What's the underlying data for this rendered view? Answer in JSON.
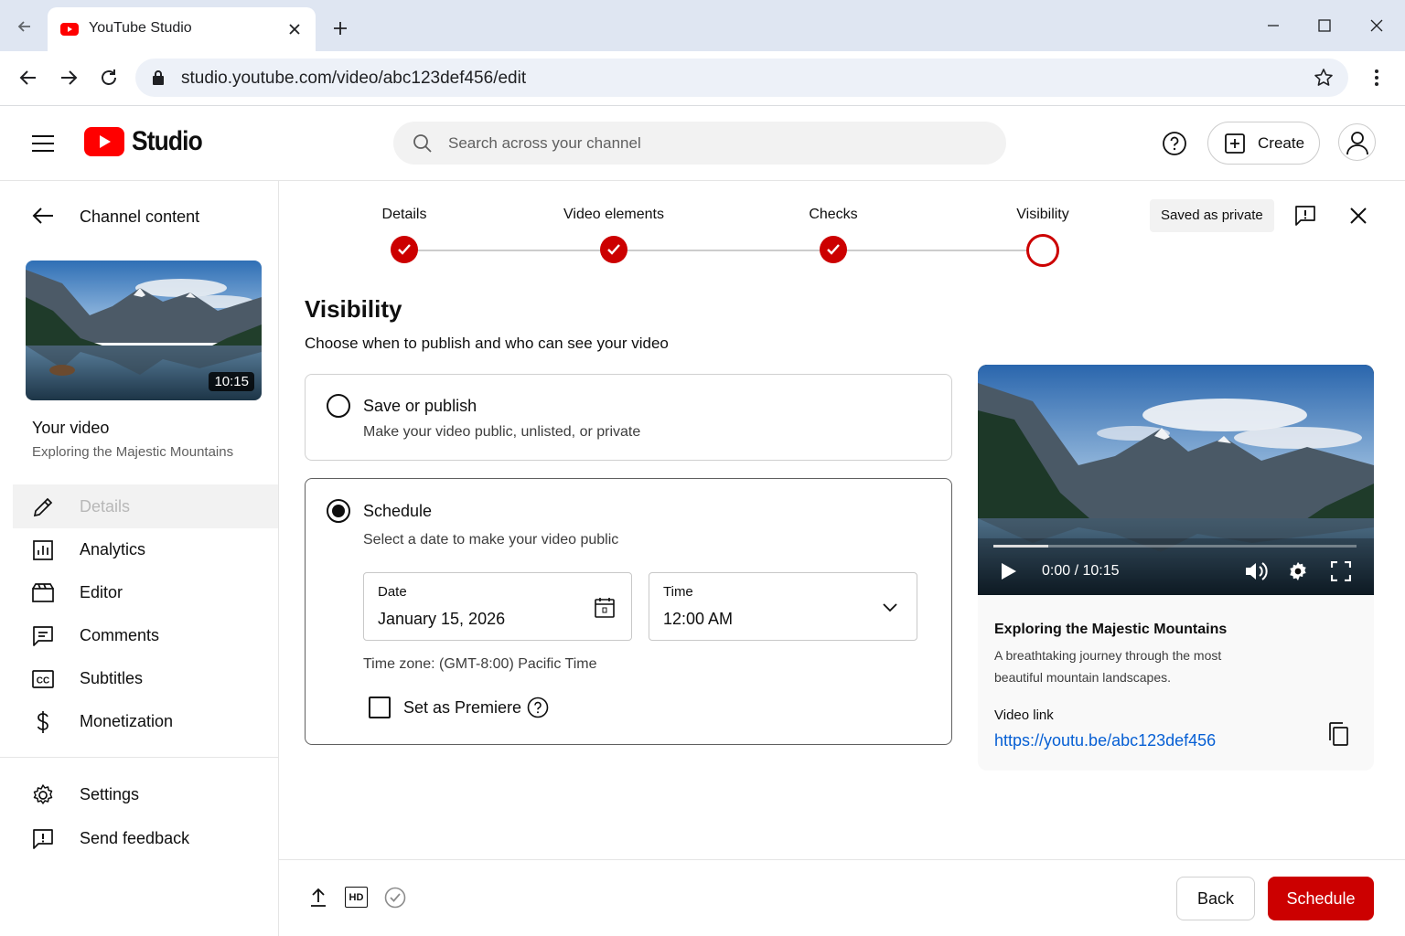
{
  "browser": {
    "tab_title": "YouTube Studio",
    "url": "studio.youtube.com/video/abc123def456/edit"
  },
  "header": {
    "logo_text": "Studio",
    "search_placeholder": "Search across your channel",
    "create_label": "Create"
  },
  "sidebar": {
    "back_label": "Channel content",
    "thumbnail_duration": "10:15",
    "your_video_label": "Your video",
    "video_title": "Exploring the Majestic Mountains",
    "items": [
      {
        "label": "Details",
        "icon": "pencil-icon",
        "active": true
      },
      {
        "label": "Analytics",
        "icon": "analytics-icon"
      },
      {
        "label": "Editor",
        "icon": "editor-icon"
      },
      {
        "label": "Comments",
        "icon": "comments-icon"
      },
      {
        "label": "Subtitles",
        "icon": "subtitles-icon"
      },
      {
        "label": "Monetization",
        "icon": "dollar-icon"
      }
    ],
    "settings_label": "Settings",
    "feedback_label": "Send feedback"
  },
  "stepper": {
    "steps": [
      {
        "label": "Details",
        "done": true
      },
      {
        "label": "Video elements",
        "done": true
      },
      {
        "label": "Checks",
        "done": true
      },
      {
        "label": "Visibility",
        "done": false
      }
    ],
    "saved_status": "Saved as private"
  },
  "visibility": {
    "title": "Visibility",
    "subtitle": "Choose when to publish and who can see your video",
    "save_option": {
      "title": "Save or publish",
      "desc": "Make your video public, unlisted, or private",
      "selected": false
    },
    "schedule_option": {
      "title": "Schedule",
      "desc": "Select a date to make your video public",
      "selected": true,
      "date_label": "Date",
      "date_value": "January 15, 2026",
      "time_label": "Time",
      "time_value": "12:00 AM",
      "timezone": "Time zone: (GMT-8:00) Pacific Time",
      "premiere_label": "Set as Premiere",
      "premiere_checked": false
    }
  },
  "preview": {
    "time_display": "0:00 / 10:15",
    "progress": 0.15,
    "title": "Exploring the Majestic Mountains",
    "desc_line1": "A breathtaking journey through the most",
    "desc_line2": "beautiful mountain landscapes.",
    "link_label": "Video link",
    "link_url": "https://youtu.be/abc123def456"
  },
  "footer": {
    "back_label": "Back",
    "schedule_label": "Schedule"
  },
  "colors": {
    "accent": "#cc0000",
    "link": "#065fd4"
  }
}
